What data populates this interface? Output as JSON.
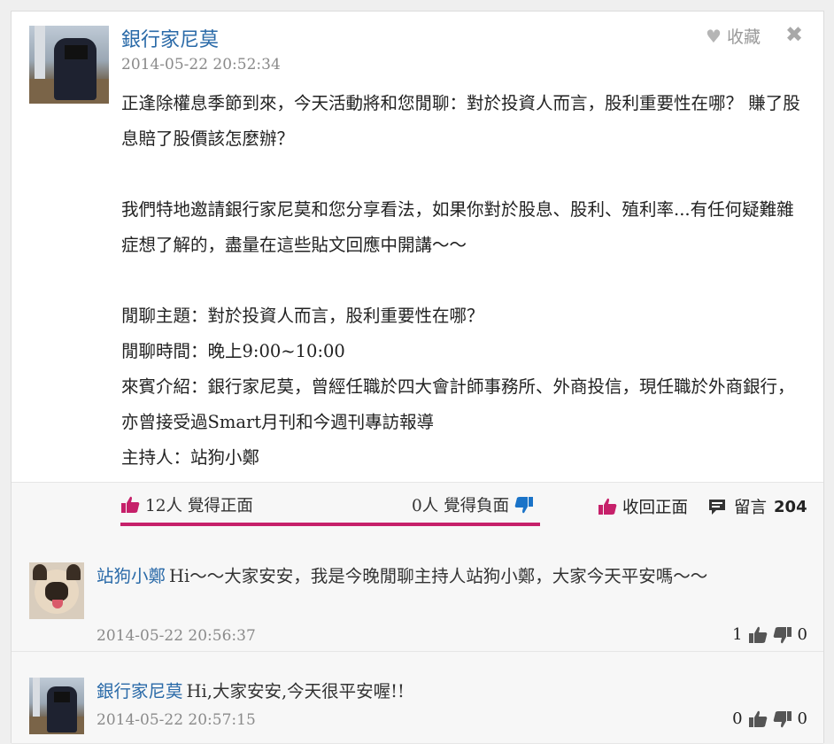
{
  "post": {
    "author": "銀行家尼莫",
    "timestamp": "2014-05-22 20:52:34",
    "bookmark_label": "收藏",
    "close_label": "✖",
    "paragraphs": [
      "正逢除權息季節到來，今天活動將和您閒聊：對於投資人而言，股利重要性在哪？ 賺了股息賠了股價該怎麼辦？",
      "",
      "我們特地邀請銀行家尼莫和您分享看法，如果你對於股息、股利、殖利率...有任何疑難雜症想了解的，盡量在這些貼文回應中開講～～",
      "",
      "閒聊主題：對於投資人而言，股利重要性在哪？",
      "閒聊時間：晚上9:00~10:00",
      "來賓介紹：銀行家尼莫，曾經任職於四大會計師事務所、外商投信，現任職於外商銀行，亦曾接受過Smart月刊和今週刊專訪報導",
      "主持人：站狗小鄭"
    ]
  },
  "reactions": {
    "positive_label": "12人 覺得正面",
    "negative_label": "0人 覺得負面",
    "retract_label": "收回正面",
    "comments_label": "留言",
    "comments_count": "204",
    "accent_color": "#c6206a",
    "negative_color": "#1a73c8"
  },
  "comments": [
    {
      "author": "站狗小鄭",
      "text": "Hi～～大家安安，我是今晚閒聊主持人站狗小鄭，大家今天平安嗎～～",
      "timestamp": "2014-05-22 20:56:37",
      "up": "1",
      "down": "0"
    },
    {
      "author": "銀行家尼莫",
      "text": "Hi,大家安安,今天很平安喔!!",
      "timestamp": "2014-05-22 20:57:15",
      "up": "0",
      "down": "0"
    }
  ]
}
